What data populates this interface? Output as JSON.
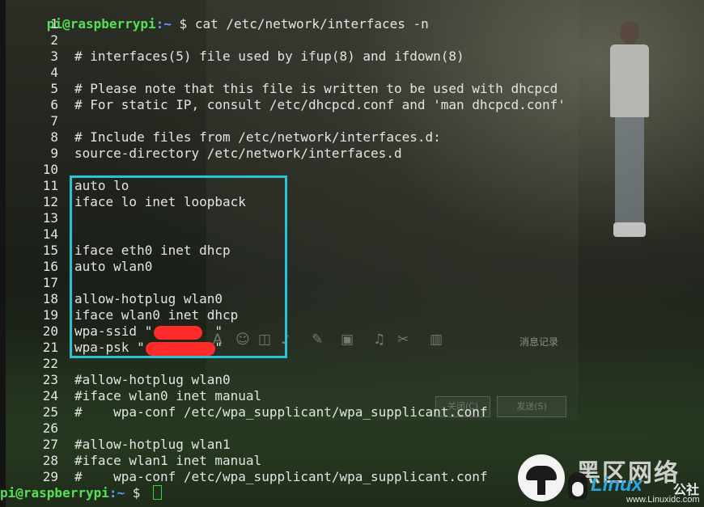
{
  "prompt": {
    "user_host": "pi@raspberrypi",
    "path": ":~",
    "symbol": " $ ",
    "command": "cat /etc/network/interfaces -n"
  },
  "lines": [
    {
      "n": "1",
      "text": ""
    },
    {
      "n": "2",
      "text": ""
    },
    {
      "n": "3",
      "text": "# interfaces(5) file used by ifup(8) and ifdown(8)"
    },
    {
      "n": "4",
      "text": ""
    },
    {
      "n": "5",
      "text": "# Please note that this file is written to be used with dhcpcd"
    },
    {
      "n": "6",
      "text": "# For static IP, consult /etc/dhcpcd.conf and 'man dhcpcd.conf'"
    },
    {
      "n": "7",
      "text": ""
    },
    {
      "n": "8",
      "text": "# Include files from /etc/network/interfaces.d:"
    },
    {
      "n": "9",
      "text": "source-directory /etc/network/interfaces.d"
    },
    {
      "n": "10",
      "text": ""
    },
    {
      "n": "11",
      "text": "auto lo"
    },
    {
      "n": "12",
      "text": "iface lo inet loopback"
    },
    {
      "n": "13",
      "text": ""
    },
    {
      "n": "14",
      "text": ""
    },
    {
      "n": "15",
      "text": "iface eth0 inet dhcp"
    },
    {
      "n": "16",
      "text": "auto wlan0"
    },
    {
      "n": "17",
      "text": ""
    },
    {
      "n": "18",
      "text": "allow-hotplug wlan0"
    },
    {
      "n": "19",
      "text": "iface wlan0 inet dhcp"
    },
    {
      "n": "20",
      "text": "wpa-ssid \"        \""
    },
    {
      "n": "21",
      "text": "wpa-psk \"         \""
    },
    {
      "n": "22",
      "text": ""
    },
    {
      "n": "23",
      "text": "#allow-hotplug wlan0"
    },
    {
      "n": "24",
      "text": "#iface wlan0 inet manual"
    },
    {
      "n": "25",
      "text": "#    wpa-conf /etc/wpa_supplicant/wpa_supplicant.conf"
    },
    {
      "n": "26",
      "text": ""
    },
    {
      "n": "27",
      "text": "#allow-hotplug wlan1"
    },
    {
      "n": "28",
      "text": "#iface wlan1 inet manual"
    },
    {
      "n": "29",
      "text": "#    wpa-conf /etc/wpa_supplicant/wpa_supplicant.conf"
    }
  ],
  "end_prompt": {
    "user_host": "pi@raspberrypi",
    "path": ":~",
    "symbol": " $ "
  },
  "wallpaper": {
    "message_log": "消息记录",
    "button_close": "关闭(C)",
    "button_send": "发送(S)"
  },
  "watermark": {
    "chinese": "黑区网络",
    "brand": "Linux",
    "brand_suffix": "公社",
    "url": "www.Linuxidc.com"
  },
  "colors": {
    "highlight_border": "#29c4d4",
    "redaction": "#ff2a2a",
    "prompt_user": "#55e055",
    "prompt_path": "#5aa0ff"
  }
}
